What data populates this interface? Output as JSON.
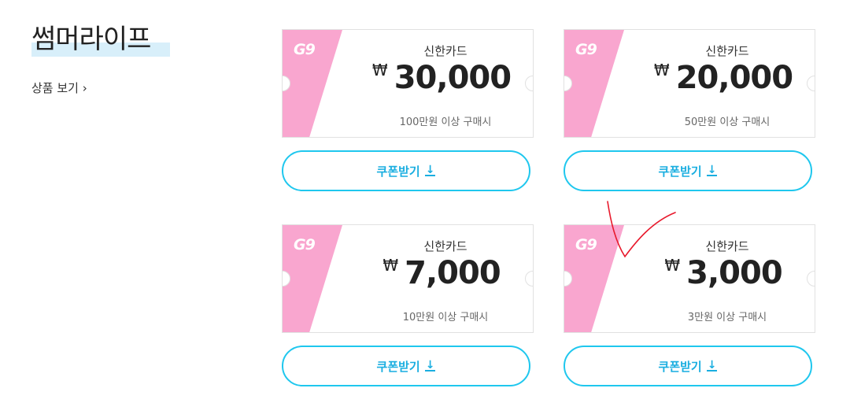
{
  "section": {
    "title": "썸머라이프",
    "link_label": "상품 보기 ›"
  },
  "coupons": [
    {
      "logo": "G9",
      "issuer": "신한카드",
      "currency": "₩",
      "amount": "30,000",
      "condition": "100만원 이상 구매시",
      "button_label": "쿠폰받기"
    },
    {
      "logo": "G9",
      "issuer": "신한카드",
      "currency": "₩",
      "amount": "20,000",
      "condition": "50만원 이상 구매시",
      "button_label": "쿠폰받기"
    },
    {
      "logo": "G9",
      "issuer": "신한카드",
      "currency": "₩",
      "amount": "7,000",
      "condition": "10만원 이상 구매시",
      "button_label": "쿠폰받기"
    },
    {
      "logo": "G9",
      "issuer": "신한카드",
      "currency": "₩",
      "amount": "3,000",
      "condition": "3만원 이상 구매시",
      "button_label": "쿠폰받기"
    }
  ],
  "icons": {
    "download": "download-arrow-icon",
    "annotation": "red-checkmark"
  },
  "colors": {
    "accent": "#1fc7ee",
    "pink": "#f9a6cf",
    "annotation": "#e8192c"
  }
}
